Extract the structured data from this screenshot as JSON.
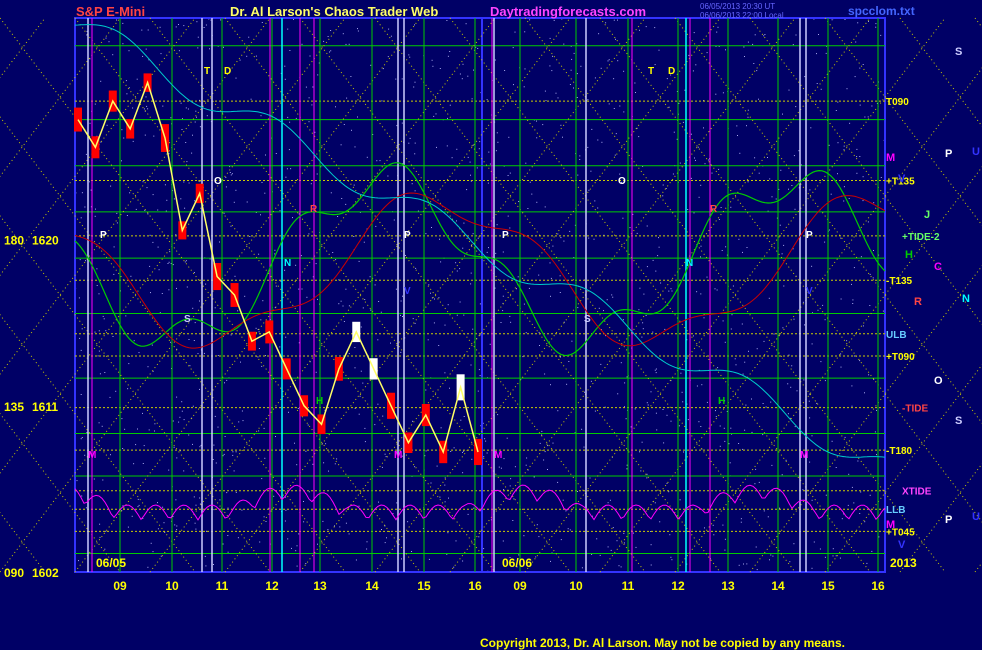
{
  "header": {
    "instrument": "S&P E-Mini",
    "title": "Dr. Al Larson's Chaos Trader Web",
    "website": "Daytradingforecasts.com",
    "file": "spcclom.txt",
    "stamp1": "06/05/2013 20:30 UT",
    "stamp2": "06/06/2013 22:00 Local"
  },
  "copyright": "Copyright 2013, Dr. Al Larson. May not be copied by any means.",
  "colors": {
    "background": "#000066",
    "frame": "#3333ff",
    "grid_green": "#00cc00",
    "grid_yellow": "#cccc00",
    "price_red": "#ff0000",
    "price_white": "#ffffff",
    "cyan_line": "#00cccc",
    "green_line": "#00cc00",
    "red_line": "#cc0000",
    "magenta_line": "#ff00ff"
  },
  "chart_data": {
    "type": "line",
    "title": "S&P E-Mini",
    "y_labels": [
      {
        "angle": "180",
        "price": "1620"
      },
      {
        "angle": "135",
        "price": "1611"
      },
      {
        "angle": "090",
        "price": "1602"
      }
    ],
    "ylim": [
      1602,
      1632
    ],
    "x_labels_panel1": [
      "09",
      "10",
      "11",
      "12",
      "13",
      "14",
      "15",
      "16"
    ],
    "x_labels_panel2": [
      "09",
      "10",
      "11",
      "12",
      "13",
      "14",
      "15",
      "16"
    ],
    "date_labels": [
      "06/05",
      "06/06",
      "2013"
    ],
    "series": [
      {
        "name": "price",
        "values": [
          1626.5,
          1625.0,
          1627.5,
          1626.0,
          1628.5,
          1625.5,
          1620.5,
          1622.5,
          1618.0,
          1617.0,
          1614.5,
          1615.0,
          1613.0,
          1611.0,
          1610.0,
          1613.0,
          1615.0,
          1613.0,
          1611.0,
          1609.0,
          1610.5,
          1608.5,
          1612.0,
          1608.5
        ]
      }
    ],
    "right_labels": [
      {
        "text": "T090",
        "price": 1627.5
      },
      {
        "text": "+T135",
        "price": 1623.2
      },
      {
        "text": "+TIDE-2",
        "price": 1620.2
      },
      {
        "text": "-T135",
        "price": 1617.8
      },
      {
        "text": "ULB",
        "price": 1614.9
      },
      {
        "text": "+T090",
        "price": 1613.7
      },
      {
        "text": "-TIDE",
        "price": 1610.9
      },
      {
        "text": "-T180",
        "price": 1608.6
      },
      {
        "text": "XTIDE",
        "price": 1606.4
      },
      {
        "text": "LLB",
        "price": 1605.4
      },
      {
        "text": "+T045",
        "price": 1604.2
      }
    ],
    "planet_symbols": [
      "S",
      "P",
      "U",
      "M",
      "V",
      "J",
      "H",
      "C",
      "R",
      "N",
      "O",
      "T",
      "D"
    ]
  }
}
